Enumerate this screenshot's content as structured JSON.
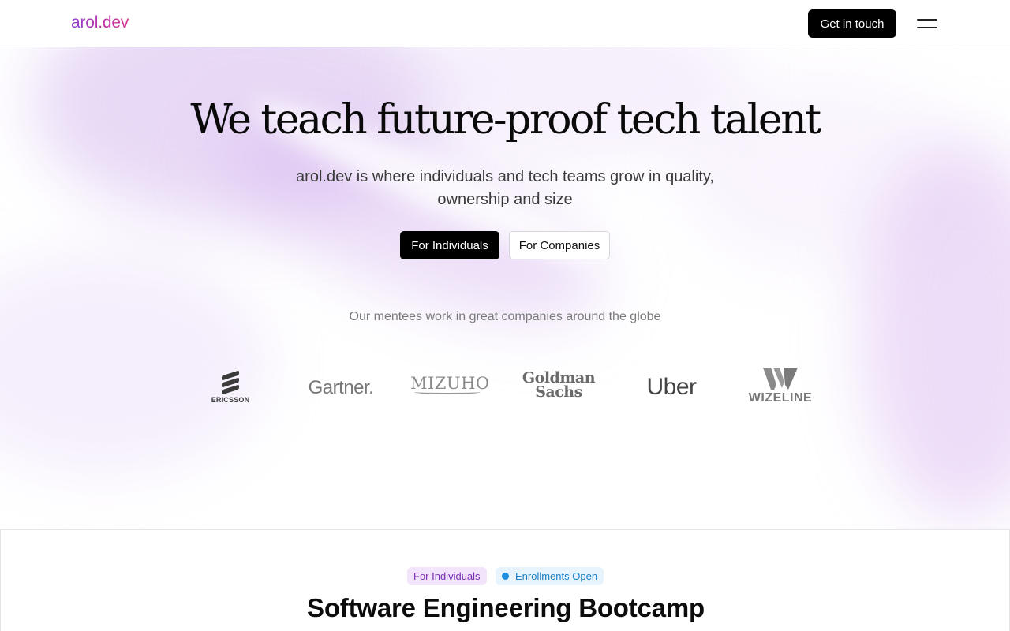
{
  "header": {
    "logo": "arol.dev",
    "cta_label": "Get in touch",
    "menu_icon": "hamburger-menu-icon"
  },
  "hero": {
    "title": "We teach future-proof tech talent",
    "subtitle": "arol.dev is where individuals and tech teams grow in quality, ownership and size",
    "buttons": {
      "individuals": "For Individuals",
      "companies": "For Companies"
    },
    "mentees_text": "Our mentees work in great companies around the globe",
    "company_logos": [
      {
        "name": "Ericsson",
        "text": "ERICSSON"
      },
      {
        "name": "Gartner",
        "text": "Gartner."
      },
      {
        "name": "Mizuho",
        "text": "MIZUHO"
      },
      {
        "name": "Goldman Sachs",
        "line1": "Goldman",
        "line2": "Sachs"
      },
      {
        "name": "Uber",
        "text": "Uber"
      },
      {
        "name": "Wizeline",
        "text": "WIZELINE"
      }
    ]
  },
  "bootcamp": {
    "tag_audience": "For Individuals",
    "tag_status": "Enrollments Open",
    "title": "Software Engineering Bootcamp"
  },
  "colors": {
    "accent_purple": "#8a3fd1",
    "accent_pink": "#d4368f",
    "button_dark": "#000000",
    "status_blue": "#1e8ee0"
  }
}
